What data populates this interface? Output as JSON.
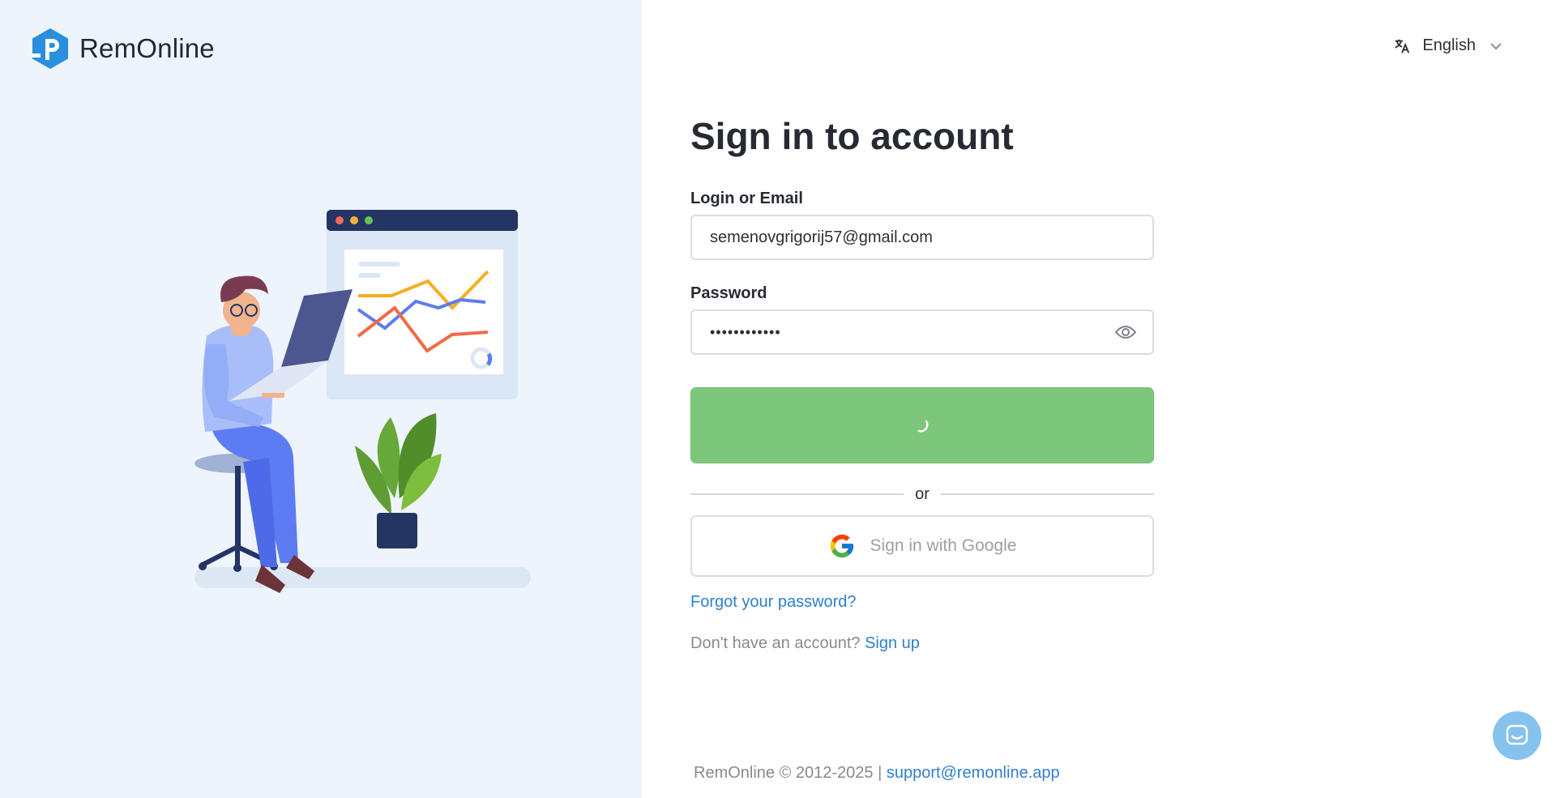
{
  "brand": {
    "name": "RemOnline"
  },
  "language": {
    "label": "English"
  },
  "form": {
    "title": "Sign in to account",
    "login_label": "Login or Email",
    "login_value": "semenovgrigorij57@gmail.com",
    "password_label": "Password",
    "password_value": "••••••••••••",
    "divider_text": "or",
    "google_label": "Sign in with Google",
    "forgot_label": "Forgot your password?",
    "no_account_text": "Don't have an account?",
    "signup_label": "Sign up"
  },
  "footer": {
    "copyright": "RemOnline © 2012-2025 |",
    "support_email": "support@remonline.app"
  },
  "colors": {
    "accent": "#2f7fcf",
    "submit_button": "#7dc77d",
    "left_background": "#edf4fc",
    "chat_button": "#86c2ee"
  },
  "icons": {
    "logo": "remonline-logo-icon",
    "language": "translate-icon",
    "chevron": "chevron-down-icon",
    "password_toggle": "eye-icon",
    "loading": "spinner-icon",
    "google": "google-g-icon",
    "chat": "chat-icon"
  }
}
